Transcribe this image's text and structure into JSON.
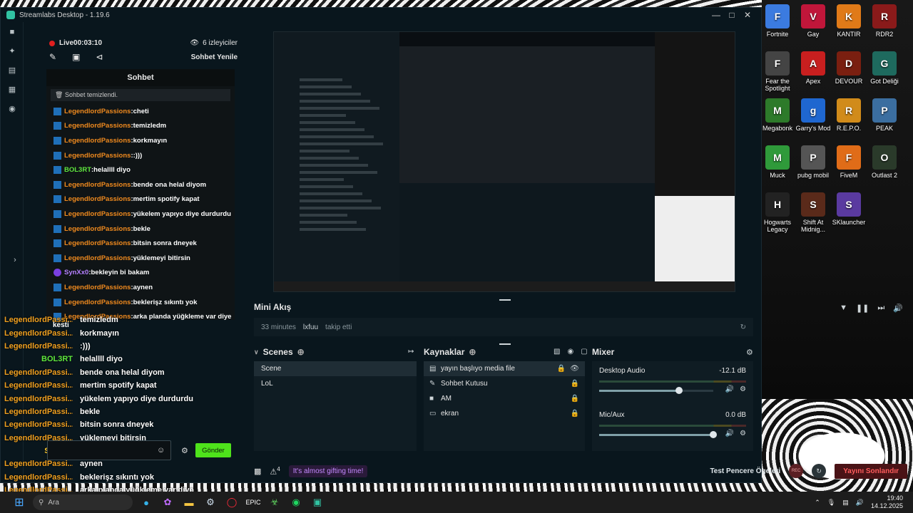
{
  "window": {
    "title": "Streamlabs Desktop - 1.19.6",
    "minimize": "—",
    "maximize": "□",
    "close": "✕"
  },
  "sidenav": [
    "home-icon",
    "themes-icon",
    "store-icon",
    "layout-icon",
    "record-icon"
  ],
  "stream": {
    "live_label": "Live",
    "live_time": "00:03:10",
    "viewers": "6 izleyiciler",
    "refresh_chat": "Sohbet Yenile"
  },
  "chat": {
    "header": "Sohbet",
    "cleared": "Sohbet temizlendi.",
    "lines": [
      {
        "nick": "LegendlordPassions",
        "msg": "cheti",
        "type": "o"
      },
      {
        "nick": "LegendlordPassions",
        "msg": "temizledm",
        "type": "o"
      },
      {
        "nick": "LegendlordPassions",
        "msg": "korkmayın",
        "type": "o"
      },
      {
        "nick": "LegendlordPassions",
        "msg": ":)))",
        "type": "o"
      },
      {
        "nick": "BOL3RT",
        "msg": "helallll diyo",
        "type": "g"
      },
      {
        "nick": "LegendlordPassions",
        "msg": "bende ona helal diyom",
        "type": "o"
      },
      {
        "nick": "LegendlordPassions",
        "msg": "mertim spotify kapat",
        "type": "o"
      },
      {
        "nick": "LegendlordPassions",
        "msg": "yükelem yapıyo diye durdurdu",
        "type": "o"
      },
      {
        "nick": "LegendlordPassions",
        "msg": "bekle",
        "type": "o"
      },
      {
        "nick": "LegendlordPassions",
        "msg": "bitsin sonra dneyek",
        "type": "o"
      },
      {
        "nick": "LegendlordPassions",
        "msg": "yüklemeyi bitirsin",
        "type": "o"
      },
      {
        "nick": "SynXx0",
        "msg": "bekleyin bi bakam",
        "type": "v"
      },
      {
        "nick": "LegendlordPassions",
        "msg": "aynen",
        "type": "o"
      },
      {
        "nick": "LegendlordPassions",
        "msg": "beklerişz sıkıntı yok",
        "type": "o"
      },
      {
        "nick": "LegendlordPassions",
        "msg": "arka planda yüğkleme var diye",
        "type": "o"
      }
    ],
    "send_label": "Gönder"
  },
  "overlay": [
    {
      "nick": "LegendlordPassi...",
      "msg": "temizledm",
      "type": "o"
    },
    {
      "nick": "LegendlordPassi...",
      "msg": "korkmayın",
      "type": "o"
    },
    {
      "nick": "LegendlordPassi...",
      "msg": ":)))",
      "type": "o"
    },
    {
      "nick": "BOL3RT",
      "msg": "helallll diyo",
      "type": "g"
    },
    {
      "nick": "LegendlordPassi...",
      "msg": "bende ona helal diyom",
      "type": "o"
    },
    {
      "nick": "LegendlordPassi...",
      "msg": "mertim spotify kapat",
      "type": "o"
    },
    {
      "nick": "LegendlordPassi...",
      "msg": "yükelem yapıyo diye durdurdu",
      "type": "o"
    },
    {
      "nick": "LegendlordPassi...",
      "msg": "bekle",
      "type": "o"
    },
    {
      "nick": "LegendlordPassi...",
      "msg": "bitsin sonra dneyek",
      "type": "o"
    },
    {
      "nick": "LegendlordPassi...",
      "msg": "yüklemeyi bitirsin",
      "type": "o"
    },
    {
      "nick": "SynXx0",
      "msg": "bekleyin bi bakam",
      "type": "y"
    },
    {
      "nick": "LegendlordPassi...",
      "msg": "aynen",
      "type": "o"
    },
    {
      "nick": "LegendlordPassi...",
      "msg": "beklerişz sıkıntı yok",
      "type": "o"
    },
    {
      "nick": "LegendlordPassi...",
      "msg": "arka planda yüğkleme var diye",
      "type": "o"
    }
  ],
  "overlay_kesti": "kesti",
  "mini_feed": {
    "title": "Mini Akış",
    "time": "33 minutes",
    "user": "lxfuu",
    "action": "takip etti"
  },
  "scenes": {
    "title": "Scenes",
    "items": [
      "Scene",
      "LoL"
    ]
  },
  "sources": {
    "title": "Kaynaklar",
    "items": [
      {
        "name": "yayın başlıyo media file",
        "icon": "media-icon"
      },
      {
        "name": "Sohbet Kutusu",
        "icon": "chat-box-icon"
      },
      {
        "name": "AM",
        "icon": "capture-icon"
      },
      {
        "name": "ekran",
        "icon": "monitor-icon"
      }
    ]
  },
  "mixer": {
    "title": "Mixer",
    "channels": [
      {
        "name": "Desktop Audio",
        "db": "-12.1 dB",
        "fader": 0.7
      },
      {
        "name": "Mic/Aux",
        "db": "0.0 dB",
        "fader": 1.0
      }
    ]
  },
  "footer": {
    "alerts_count": "4",
    "gift": "It's almost gifting time!",
    "test": "Test Pencere Ögeleri",
    "rec": "REC",
    "end": "Yayını Sonlandır"
  },
  "desktop_icons": [
    {
      "label": "Fortnite",
      "color": "#3b7be0",
      "glyph": "F"
    },
    {
      "label": "Gay",
      "color": "#c0163a",
      "glyph": "V"
    },
    {
      "label": "KANTIR",
      "color": "#e07a18",
      "glyph": "K"
    },
    {
      "label": "RDR2",
      "color": "#8a1a1a",
      "glyph": "R"
    },
    {
      "label": "Fear the Spotlight",
      "color": "#444444",
      "glyph": "F"
    },
    {
      "label": "Apex",
      "color": "#c81f1f",
      "glyph": "A"
    },
    {
      "label": "DEVOUR",
      "color": "#7a1f10",
      "glyph": "D"
    },
    {
      "label": "Got Deliği",
      "color": "#1e6a5e",
      "glyph": "G"
    },
    {
      "label": "Megabonk",
      "color": "#2d7a2a",
      "glyph": "M"
    },
    {
      "label": "Garry's Mod",
      "color": "#1f67d0",
      "glyph": "g"
    },
    {
      "label": "R.E.P.O.",
      "color": "#d18b1a",
      "glyph": "R"
    },
    {
      "label": "PEAK",
      "color": "#3b6ea0",
      "glyph": "P"
    },
    {
      "label": "Muck",
      "color": "#2f9a3a",
      "glyph": "M"
    },
    {
      "label": "pubg mobil",
      "color": "#555555",
      "glyph": "P"
    },
    {
      "label": "FiveM",
      "color": "#e06c18",
      "glyph": "F"
    },
    {
      "label": "Outlast 2",
      "color": "#2a3a2a",
      "glyph": "O"
    },
    {
      "label": "Hogwarts Legacy",
      "color": "#222222",
      "glyph": "H"
    },
    {
      "label": "Shift At Midnig...",
      "color": "#5a2a1a",
      "glyph": "S"
    },
    {
      "label": "SKlauncher",
      "color": "#5a3aa0",
      "glyph": "S"
    }
  ],
  "taskbar": {
    "search": "Ara",
    "time": "19:40",
    "date": "14.12.2025"
  }
}
